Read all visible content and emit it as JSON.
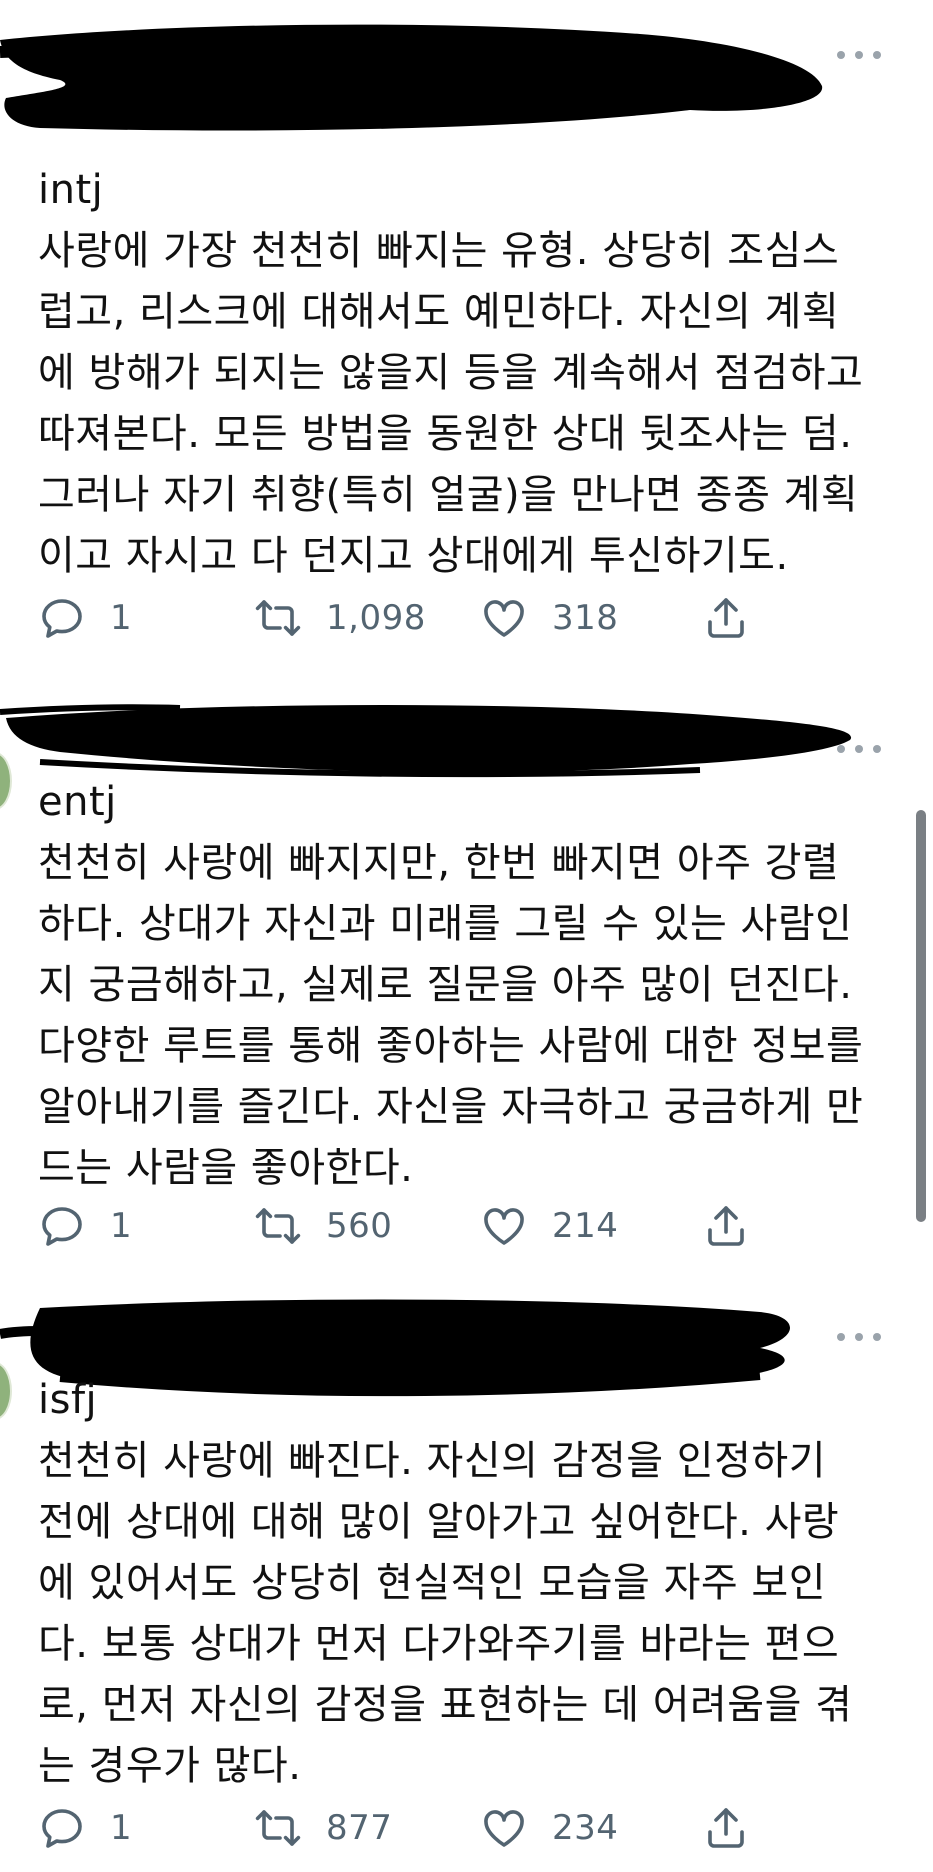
{
  "tweets": [
    {
      "handle": "intj",
      "lines": [
        "사랑에 가장 천천히 빠지는 유형. 상당히 조심스",
        "럽고, 리스크에 대해서도 예민하다. 자신의 계획",
        "에 방해가 되지는 않을지 등을 계속해서 점검하고",
        "따져본다. 모든 방법을 동원한 상대 뒷조사는 덤.",
        "그러나 자기 취향(특히 얼굴)을 만나면 종종 계획",
        "이고 자시고 다 던지고 상대에게 투신하기도."
      ],
      "replies": "1",
      "retweets": "1,098",
      "likes": "318"
    },
    {
      "handle": "entj",
      "lines": [
        "천천히 사랑에 빠지지만, 한번 빠지면 아주 강렬",
        "하다. 상대가 자신과 미래를 그릴 수 있는 사람인",
        "지 궁금해하고, 실제로 질문을 아주 많이 던진다.",
        "다양한 루트를 통해 좋아하는 사람에 대한 정보를",
        "알아내기를 즐긴다. 자신을 자극하고 궁금하게 만",
        "드는 사람을 좋아한다."
      ],
      "replies": "1",
      "retweets": "560",
      "likes": "214"
    },
    {
      "handle": "isfj",
      "lines": [
        "천천히 사랑에 빠진다. 자신의 감정을 인정하기",
        "전에 상대에 대해 많이 알아가고 싶어한다. 사랑",
        "에 있어서도 상당히 현실적인 모습을 자주 보인",
        "다. 보통 상대가 먼저 다가와주기를 바라는 편으",
        "로, 먼저 자신의 감정을 표현하는 데 어려움을 겪",
        "는 경우가 많다."
      ],
      "replies": "1",
      "retweets": "877",
      "likes": "234"
    }
  ],
  "icons": {
    "reply": "speech-bubble-icon",
    "retweet": "retweet-arrows-icon",
    "like": "heart-icon",
    "share": "share-upload-icon",
    "more": "more-dots-icon"
  },
  "colors": {
    "text": "#111111",
    "action_gray": "#536471",
    "redaction": "#000000"
  }
}
